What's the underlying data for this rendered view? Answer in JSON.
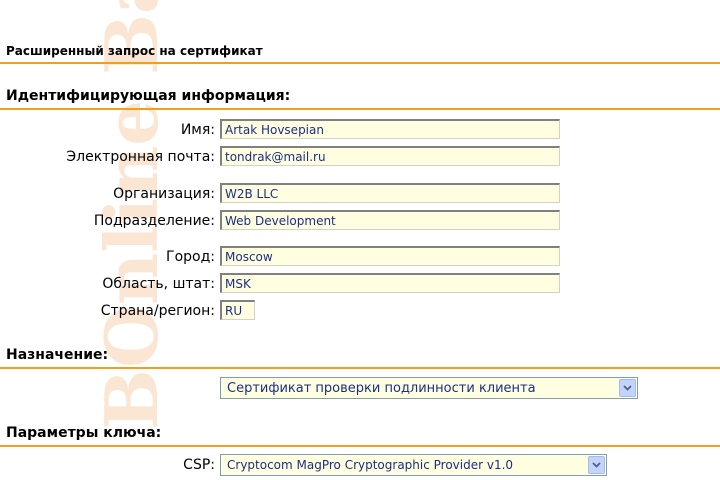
{
  "watermark": "BOnline Banking",
  "page_title": "Расширенный запрос на сертификат",
  "sections": {
    "identity": "Идентифицирующая информация:",
    "purpose": "Назначение:",
    "key": "Параметры ключа:"
  },
  "fields": {
    "name": {
      "label": "Имя:",
      "value": "Artak Hovsepian"
    },
    "email": {
      "label": "Электронная почта:",
      "value": "tondrak@mail.ru"
    },
    "org": {
      "label": "Организация:",
      "value": "W2B LLC"
    },
    "unit": {
      "label": "Подразделение:",
      "value": "Web Development"
    },
    "city": {
      "label": "Город:",
      "value": "Moscow"
    },
    "state": {
      "label": "Область, штат:",
      "value": "MSK"
    },
    "country": {
      "label": "Страна/регион:",
      "value": "RU"
    }
  },
  "purpose_select": {
    "value": "Сертификат проверки подлинности клиента"
  },
  "csp": {
    "label": "CSP:",
    "value": "Cryptocom MagPro Cryptographic Provider v1.0"
  },
  "colors": {
    "accent": "#f0a020",
    "field_bg": "#fffee0",
    "field_text": "#1a2f8a"
  }
}
